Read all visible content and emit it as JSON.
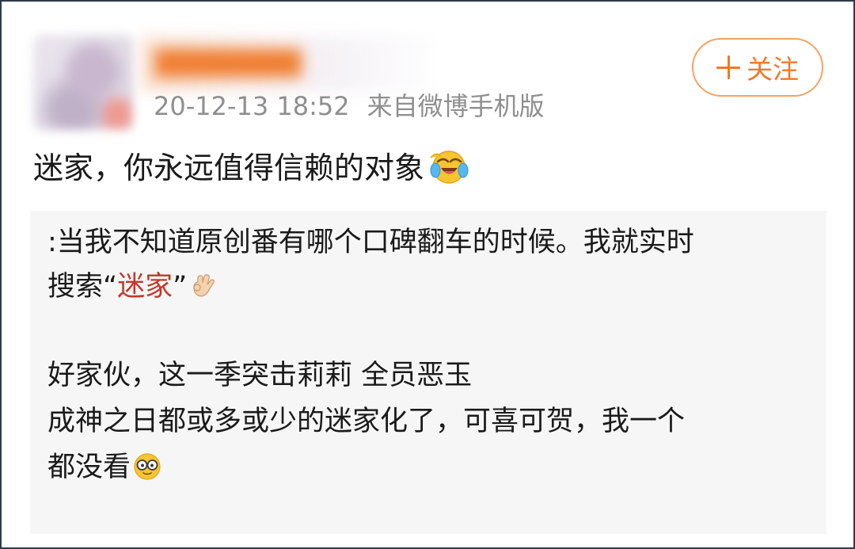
{
  "post": {
    "author_name": "████████",
    "timestamp": "20-12-13 18:52",
    "source": "来自微博手机版",
    "follow_label": "关注",
    "text": "迷家，你永远值得信赖的对象",
    "text_emoji": "laugh-cry-emoji"
  },
  "repost": {
    "line1": ":当我不知道原创番有哪个口碑翻车的时候。我就实时",
    "line2_prefix": "搜索“",
    "line2_highlight": "迷家",
    "line2_suffix": "”",
    "line2_emoji": "ok-hand-emoji",
    "line3": "好家伙，这一季突击莉莉 全员恶玉",
    "line4": "成神之日都或多或少的迷家化了，可喜可贺，我一个",
    "line5": "都没看",
    "line5_emoji": "nerd-glasses-emoji"
  },
  "colors": {
    "accent": "#ee7a2a",
    "follow_border": "#f5a35f",
    "highlight": "#c0392b",
    "meta_text": "#8f8f8f",
    "repost_bg": "#f6f6f6"
  }
}
